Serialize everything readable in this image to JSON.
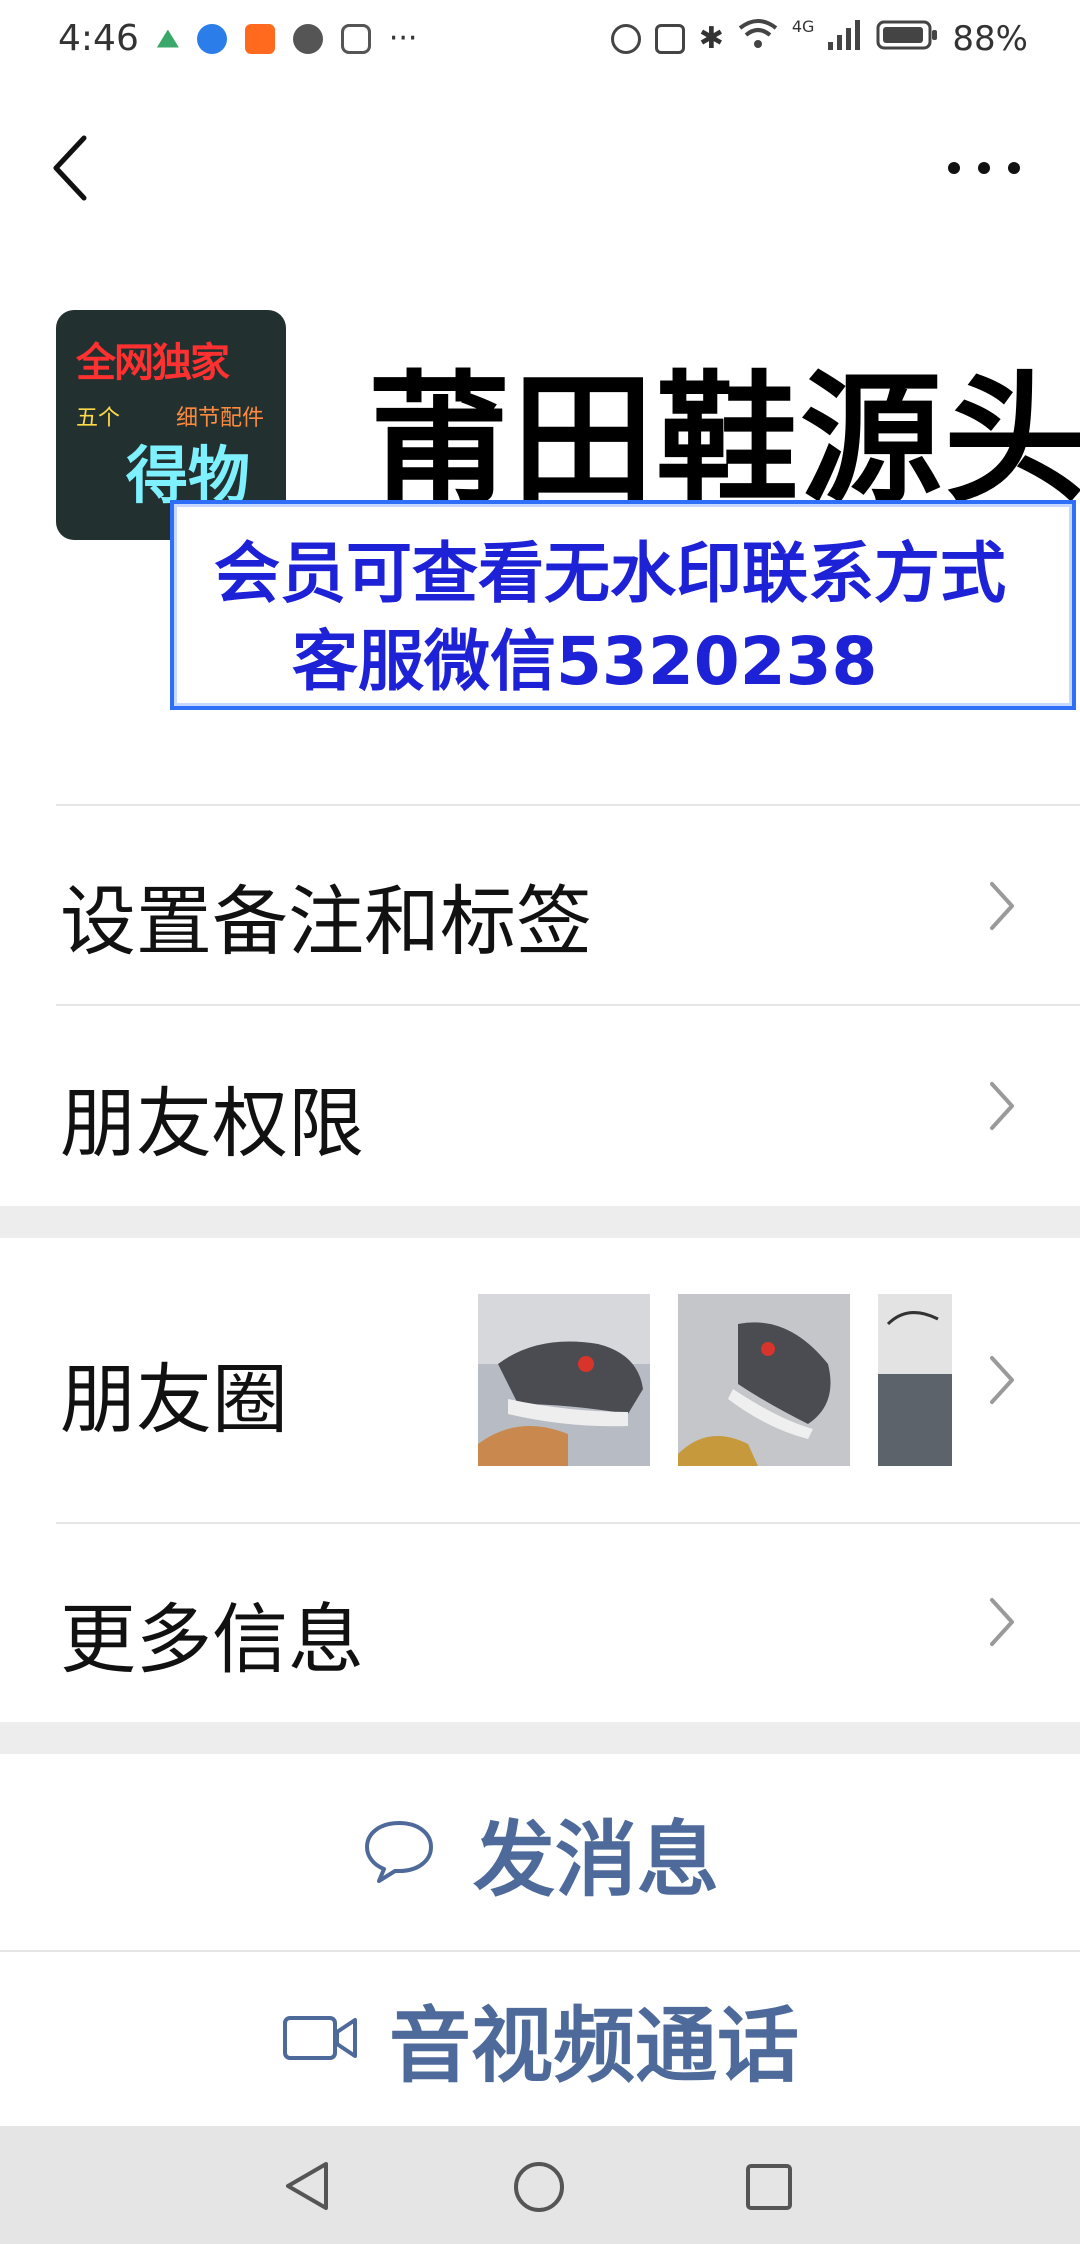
{
  "status_bar": {
    "time": "4:46",
    "battery": "88%",
    "network": "4G"
  },
  "profile": {
    "name": "莆田鞋源头",
    "avatar_text_top": "全网独家",
    "avatar_text_small_left": "五个",
    "avatar_text_small_right": "细节配件",
    "avatar_text_big": "得物",
    "watermark_line1": "会员可查看无水印联系方式",
    "watermark_line2": "客服微信5320238"
  },
  "menu": {
    "remark_tags": "设置备注和标签",
    "friend_permissions": "朋友权限",
    "moments": "朋友圈",
    "more_info": "更多信息"
  },
  "actions": {
    "send_message": "发消息",
    "video_call": "音视频通话"
  },
  "colors": {
    "action_text": "#4d6a9a",
    "watermark_text": "#1e22d6",
    "section_gap": "#ededed"
  }
}
